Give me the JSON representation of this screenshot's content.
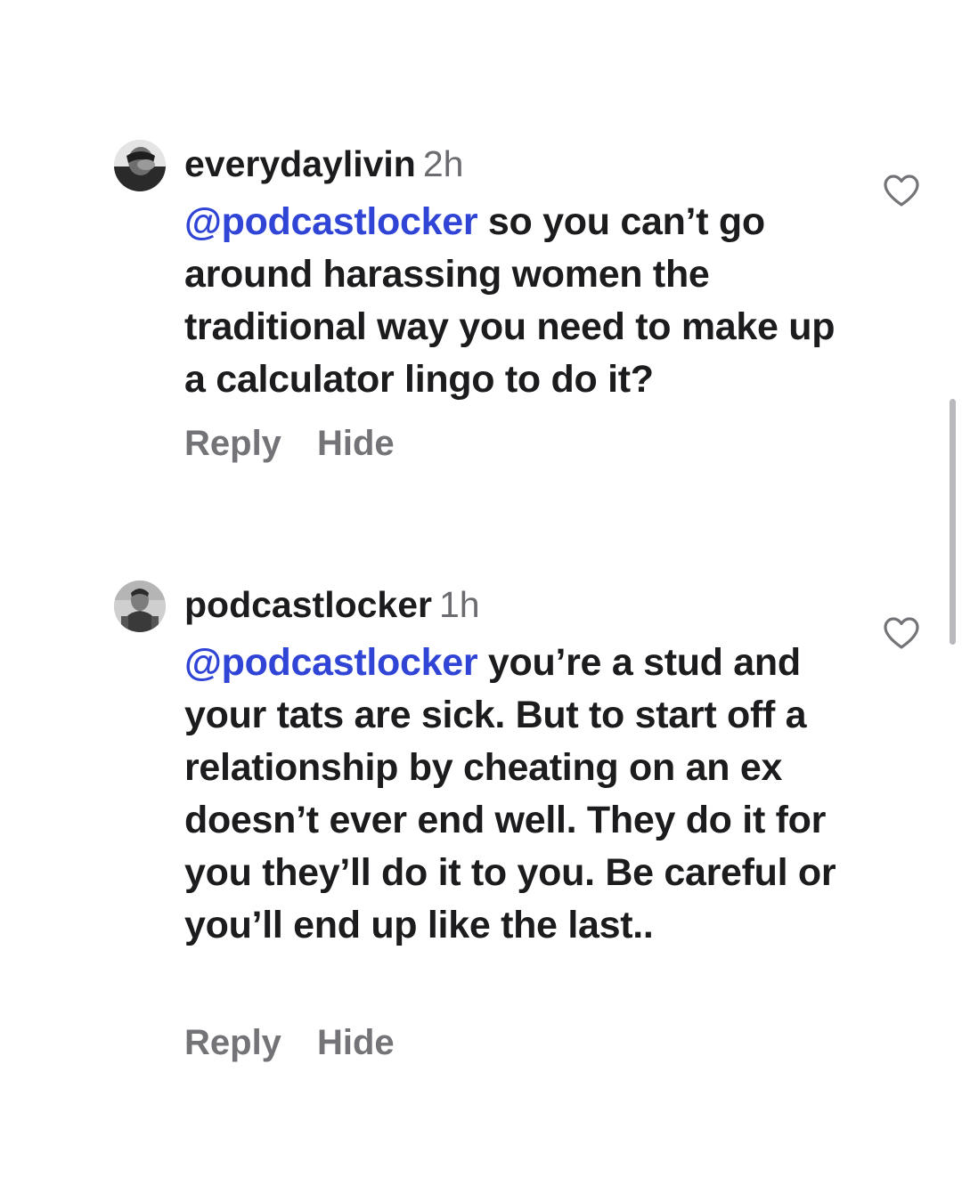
{
  "comments": [
    {
      "username": "everydaylivin",
      "time": "2h",
      "mention": "@podcastlocker",
      "text": " so you can’t go around harassing women the traditional way you need to make up a calculator lingo to do it?",
      "reply_label": "Reply",
      "hide_label": "Hide",
      "like_icon": "heart-outline-icon",
      "avatar_icon": "profile-photo"
    },
    {
      "username": "podcastlocker",
      "time": "1h",
      "mention": "@podcastlocker",
      "text": " you’re a stud and your tats are sick. But to start off a relationship by cheating on an ex doesn’t ever end well. They do it for you they’ll do it to you. Be careful or you’ll end up like the last..",
      "reply_label": "Reply",
      "hide_label": "Hide",
      "like_icon": "heart-outline-icon",
      "avatar_icon": "profile-photo"
    }
  ],
  "colors": {
    "mention": "#3044d6",
    "text": "#1c1c1e",
    "muted": "#737378",
    "background": "#ffffff",
    "scrollbar": "#b9b9bd"
  }
}
